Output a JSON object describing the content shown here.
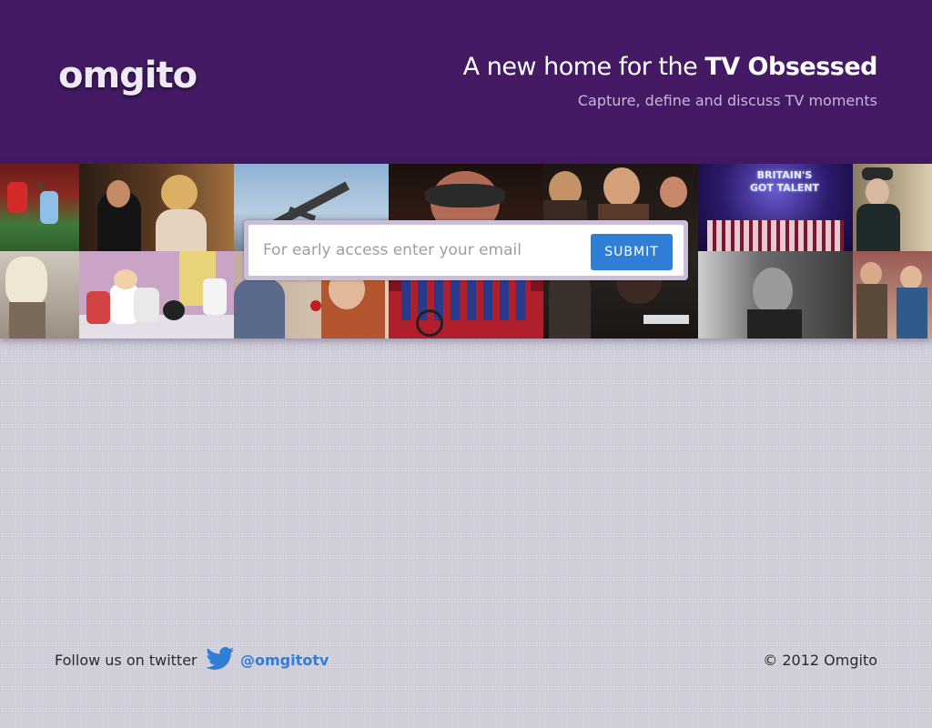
{
  "header": {
    "logo": "omgito",
    "tagline_prefix": "A new home for the ",
    "tagline_emphasis": "TV Obsessed",
    "subtagline": "Capture, define and discuss TV moments"
  },
  "mosaic": {
    "tiles": [
      {
        "name": "tile-football"
      },
      {
        "name": "tile-drama-couple"
      },
      {
        "name": "tile-sky-boat"
      },
      {
        "name": "tile-masquerade-mask"
      },
      {
        "name": "tile-doctor-who-cast"
      },
      {
        "name": "tile-britains-got-talent",
        "text": "BRITAIN'S GOT TALENT"
      },
      {
        "name": "tile-period-lady"
      },
      {
        "name": "tile-blonde-woman"
      },
      {
        "name": "tile-family-guy"
      },
      {
        "name": "tile-glee-dancers"
      },
      {
        "name": "tile-dark-drama"
      },
      {
        "name": "tile-black-white-man"
      },
      {
        "name": "tile-family-drama"
      }
    ]
  },
  "signup": {
    "placeholder": "For early access enter your email",
    "submit_label": "SUBMIT"
  },
  "footer": {
    "follow_text": "Follow us on twitter",
    "twitter_handle": "@omgitotv",
    "copyright": "© 2012 Omgito"
  },
  "colors": {
    "header_bg": "#431a63",
    "accent_blue": "#2f7fd6",
    "page_bg": "#d2d0dc"
  }
}
